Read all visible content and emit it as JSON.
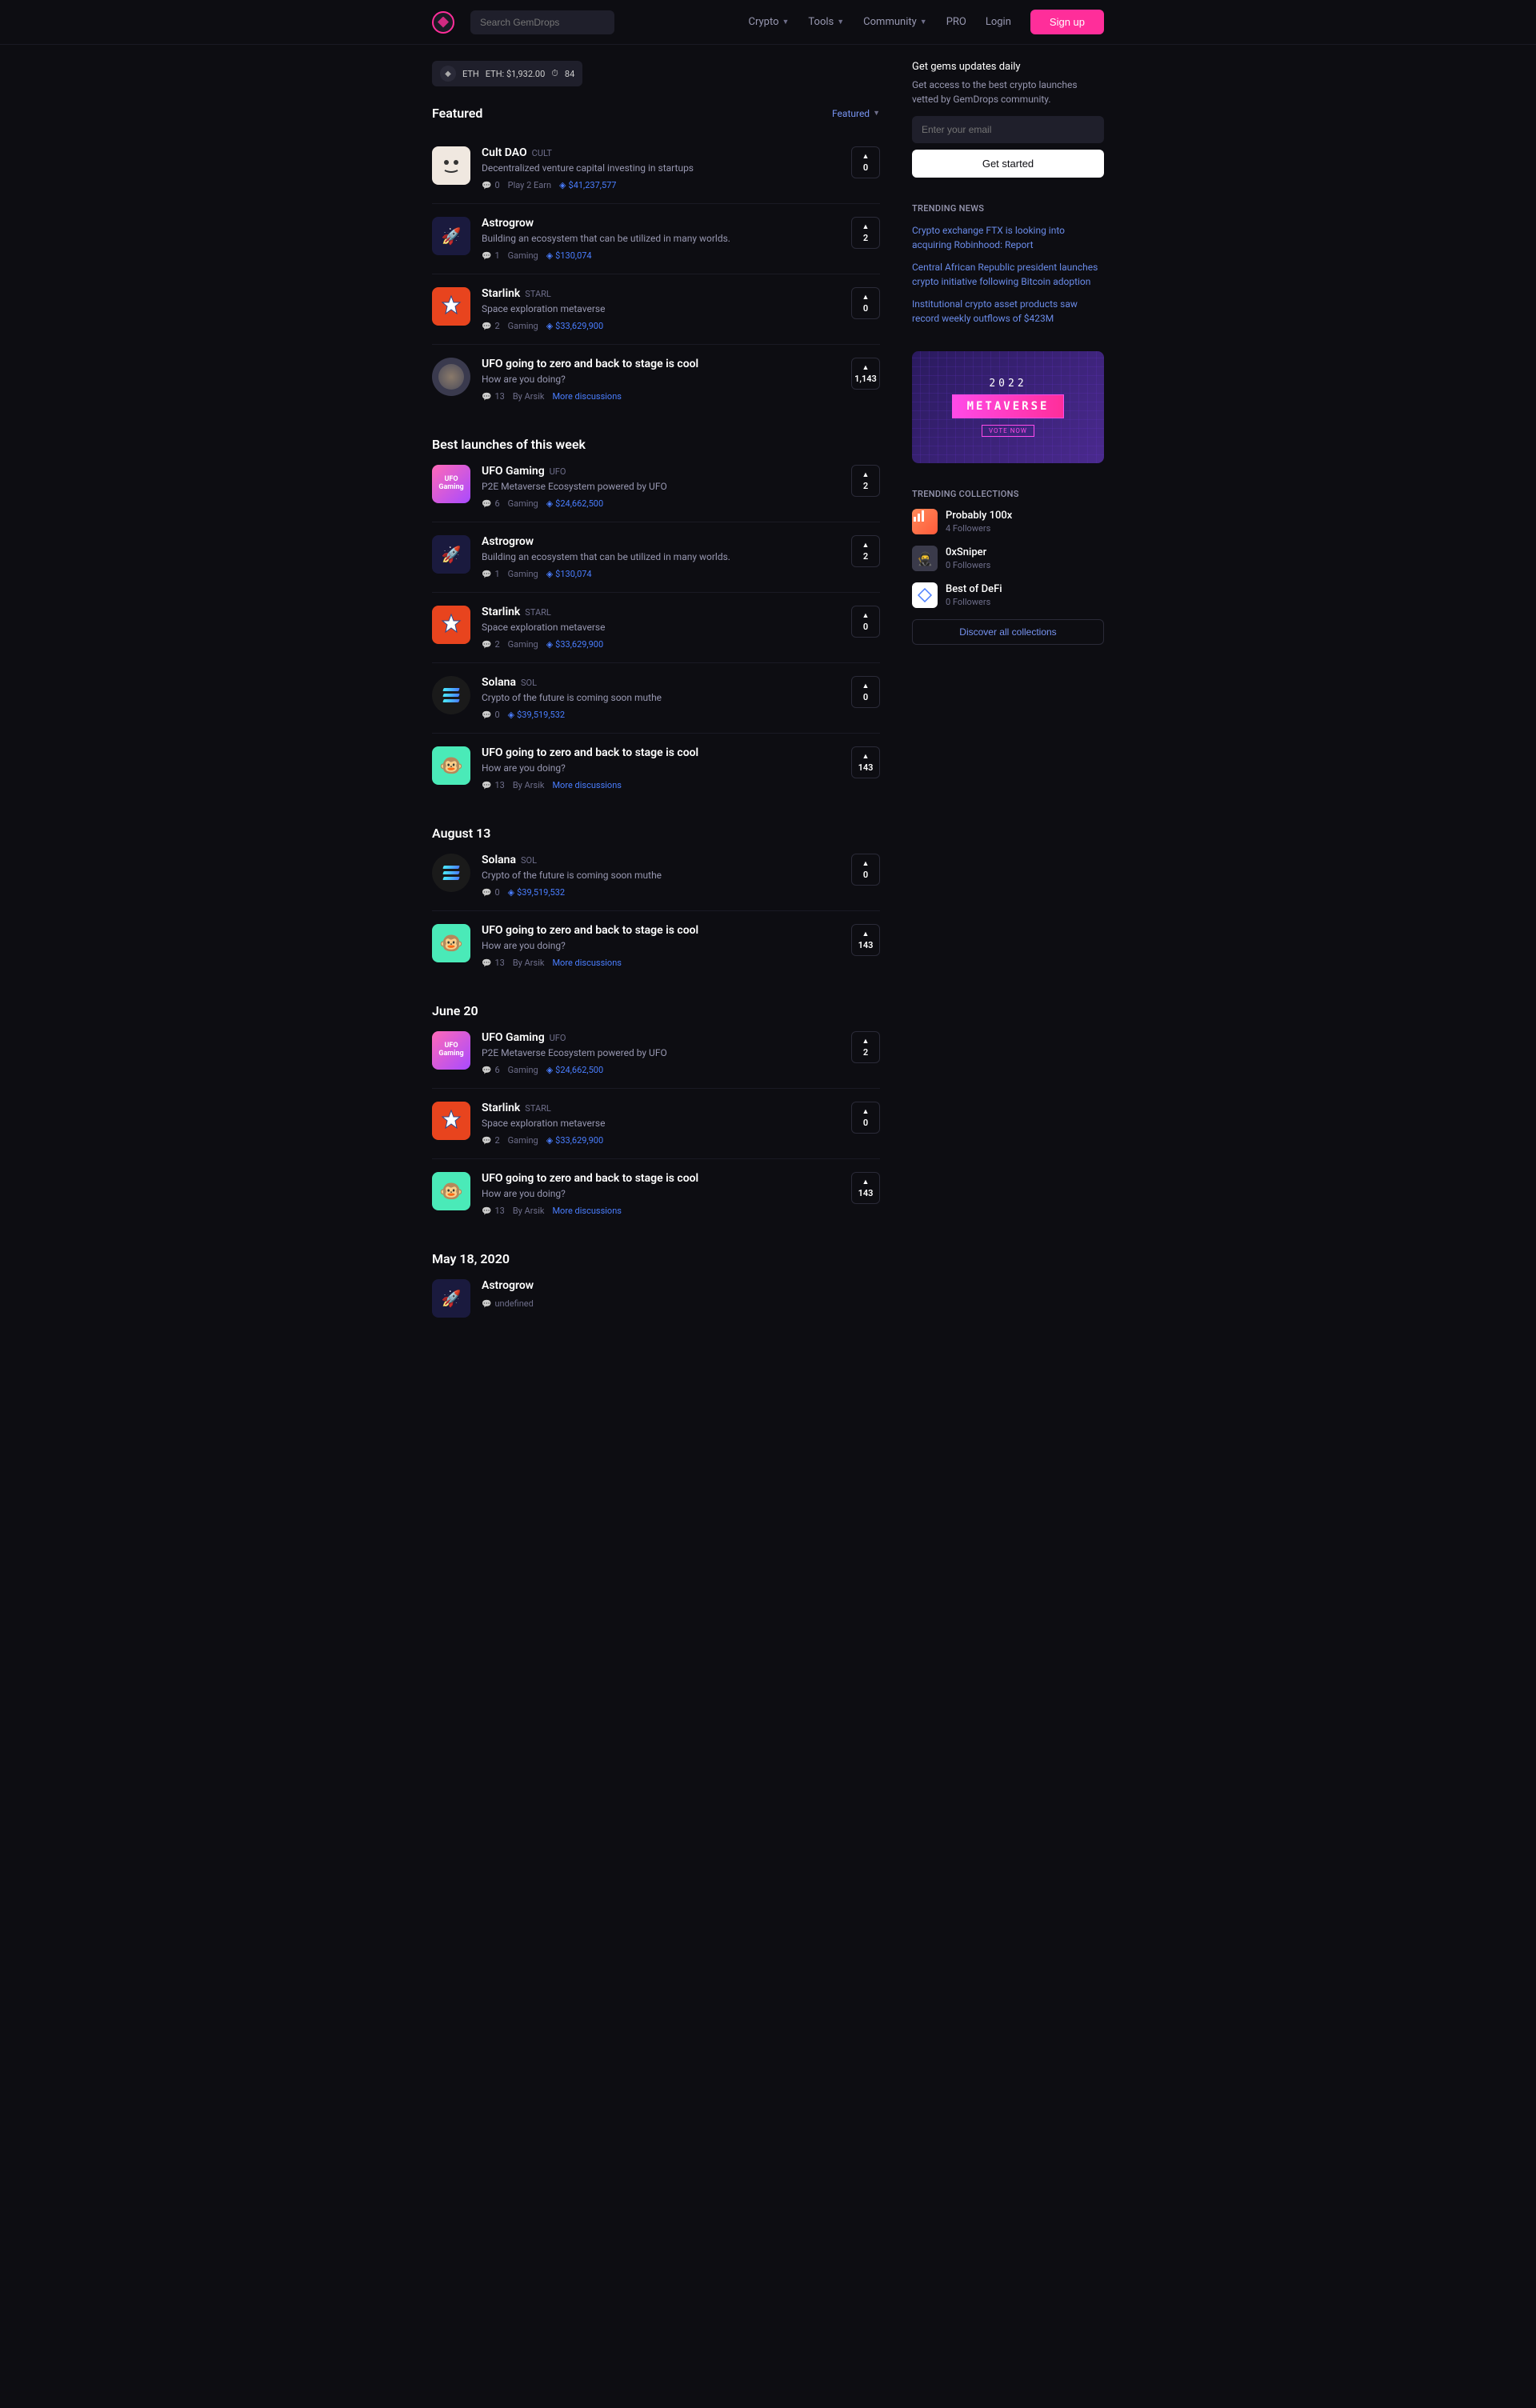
{
  "header": {
    "search_placeholder": "Search GemDrops",
    "nav": {
      "crypto": "Crypto",
      "tools": "Tools",
      "community": "Community",
      "pro": "PRO",
      "login": "Login",
      "signup": "Sign up"
    }
  },
  "eth_badge": {
    "symbol": "ETH",
    "price": "ETH: $1,932.00",
    "gas": "84"
  },
  "featured": {
    "title": "Featured",
    "dropdown": "Featured",
    "items": [
      {
        "name": "Cult DAO",
        "ticker": "CULT",
        "desc": "Decentralized venture capital investing in startups",
        "comments": "0",
        "tag": "Play 2 Earn",
        "cap": "$41,237,577",
        "votes": "0",
        "icon": "cult"
      },
      {
        "name": "Astrogrow",
        "ticker": "",
        "desc": "Building an ecosystem that can be utilized in many worlds.",
        "comments": "1",
        "tag": "Gaming",
        "cap": "$130,074",
        "votes": "2",
        "icon": "astro"
      },
      {
        "name": "Starlink",
        "ticker": "STARL",
        "desc": "Space exploration metaverse",
        "comments": "2",
        "tag": "Gaming",
        "cap": "$33,629,900",
        "votes": "0",
        "icon": "starlink"
      },
      {
        "name": "UFO going to zero and back to stage is cool",
        "ticker": "",
        "desc": "How are you doing?",
        "comments": "13",
        "author": "By Arsik",
        "more": "More discussions",
        "votes": "1,143",
        "icon": "ufo-disc",
        "is_discussion": true
      }
    ]
  },
  "best": {
    "title": "Best launches of this week",
    "items": [
      {
        "name": "UFO Gaming",
        "ticker": "UFO",
        "desc": "P2E Metaverse Ecosystem powered by UFO",
        "comments": "6",
        "tag": "Gaming",
        "cap": "$24,662,500",
        "votes": "2",
        "icon": "ufo-gaming"
      },
      {
        "name": "Astrogrow",
        "ticker": "",
        "desc": "Building an ecosystem that can be utilized in many worlds.",
        "comments": "1",
        "tag": "Gaming",
        "cap": "$130,074",
        "votes": "2",
        "icon": "astro"
      },
      {
        "name": "Starlink",
        "ticker": "STARL",
        "desc": "Space exploration metaverse",
        "comments": "2",
        "tag": "Gaming",
        "cap": "$33,629,900",
        "votes": "0",
        "icon": "starlink"
      },
      {
        "name": "Solana",
        "ticker": "SOL",
        "desc": "Crypto of the future is coming soon muthe",
        "comments": "0",
        "tag": "",
        "cap": "$39,519,532",
        "votes": "0",
        "icon": "solana"
      },
      {
        "name": "UFO going to zero and back to stage is cool",
        "ticker": "",
        "desc": "How are you doing?",
        "comments": "13",
        "author": "By Arsik",
        "more": "More discussions",
        "votes": "143",
        "icon": "ape",
        "is_discussion": true
      }
    ]
  },
  "aug13": {
    "title": "August 13",
    "items": [
      {
        "name": "Solana",
        "ticker": "SOL",
        "desc": "Crypto of the future is coming soon muthe",
        "comments": "0",
        "tag": "",
        "cap": "$39,519,532",
        "votes": "0",
        "icon": "solana"
      },
      {
        "name": "UFO going to zero and back to stage is cool",
        "ticker": "",
        "desc": "How are you doing?",
        "comments": "13",
        "author": "By Arsik",
        "more": "More discussions",
        "votes": "143",
        "icon": "ape",
        "is_discussion": true
      }
    ]
  },
  "jun20": {
    "title": "June 20",
    "items": [
      {
        "name": "UFO Gaming",
        "ticker": "UFO",
        "desc": "P2E Metaverse Ecosystem powered by UFO",
        "comments": "6",
        "tag": "Gaming",
        "cap": "$24,662,500",
        "votes": "2",
        "icon": "ufo-gaming"
      },
      {
        "name": "Starlink",
        "ticker": "STARL",
        "desc": "Space exploration metaverse",
        "comments": "2",
        "tag": "Gaming",
        "cap": "$33,629,900",
        "votes": "0",
        "icon": "starlink"
      },
      {
        "name": "UFO going to zero and back to stage is cool",
        "ticker": "",
        "desc": "How are you doing?",
        "comments": "13",
        "author": "By Arsik",
        "more": "More discussions",
        "votes": "143",
        "icon": "ape",
        "is_discussion": true
      }
    ]
  },
  "may18": {
    "title": "May 18, 2020",
    "items": [
      {
        "name": "Astrogrow",
        "ticker": "",
        "desc": "",
        "icon": "astro"
      }
    ]
  },
  "sidebar": {
    "updates_title": "Get gems updates daily",
    "updates_sub": "Get access to the best crypto launches vetted by GemDrops community.",
    "email_placeholder": "Enter your email",
    "get_started": "Get started",
    "trending_news": "TRENDING NEWS",
    "news": [
      "Crypto exchange FTX is looking into acquiring Robinhood: Report",
      "Central African Republic president launches crypto initiative following Bitcoin adoption",
      "Institutional crypto asset products saw record weekly outflows of $423M"
    ],
    "promo_year": "2022",
    "promo_title": "METAVERSE",
    "promo_cta": "VOTE NOW",
    "trending_collections": "TRENDING COLLECTIONS",
    "collections": [
      {
        "name": "Probably 100x",
        "followers": "4 Followers",
        "icon": "prob"
      },
      {
        "name": "0xSniper",
        "followers": "0 Followers",
        "icon": "sniper"
      },
      {
        "name": "Best of DeFi",
        "followers": "0 Followers",
        "icon": "defi"
      }
    ],
    "discover": "Discover all collections"
  }
}
